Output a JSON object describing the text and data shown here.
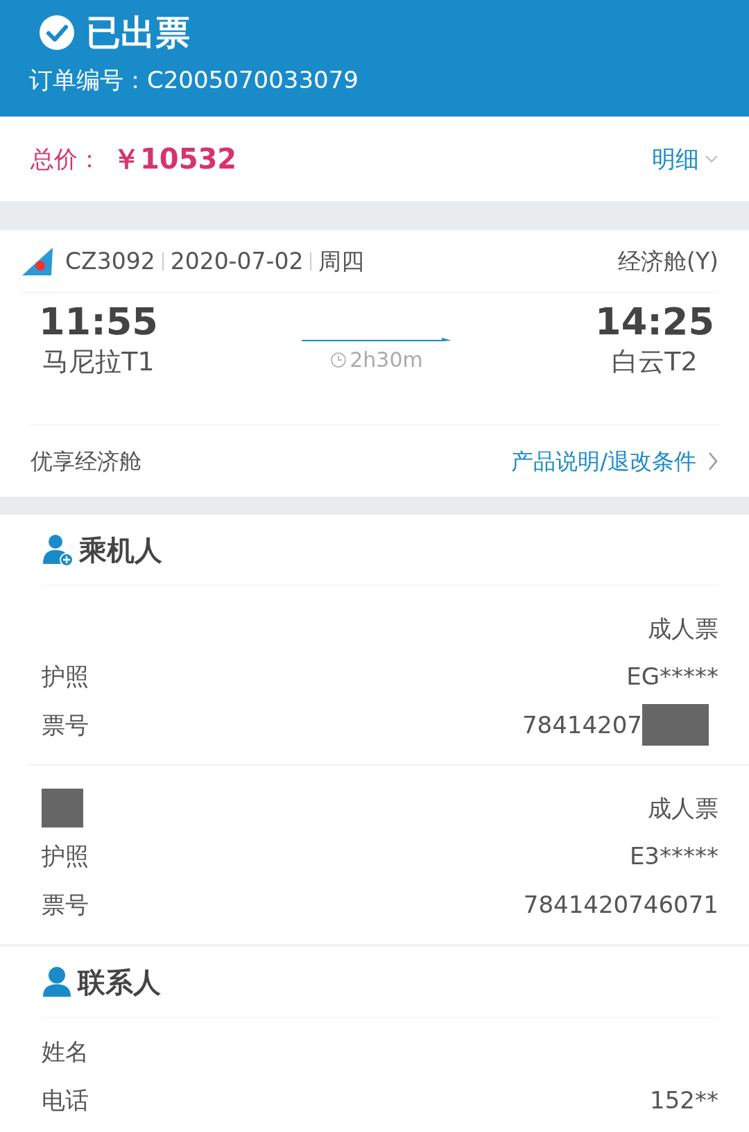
{
  "header": {
    "status": "已出票",
    "order_label": "订单编号：",
    "order_number": "C2005070033079"
  },
  "price": {
    "label": "总价：",
    "amount": "￥10532",
    "detail_link": "明细"
  },
  "flight": {
    "number": "CZ3092",
    "date": "2020-07-02",
    "weekday": "周四",
    "cabin": "经济舱(Y)",
    "departure": {
      "time": "11:55",
      "airport": "马尼拉T1"
    },
    "duration": "2h30m",
    "arrival": {
      "time": "14:25",
      "airport": "白云T2"
    },
    "product": "优享经济舱",
    "rules_link": "产品说明/退改条件"
  },
  "passengers": {
    "title": "乘机人",
    "items": [
      {
        "name_redacted": false,
        "ticket_type": "成人票",
        "passport_label": "护照",
        "passport": "EG*****",
        "ticket_label": "票号",
        "ticket_number": "78414207",
        "number_redacted": true
      },
      {
        "name_redacted": true,
        "ticket_type": "成人票",
        "passport_label": "护照",
        "passport": "E3*****",
        "ticket_label": "票号",
        "ticket_number": "7841420746071",
        "number_redacted": false
      }
    ]
  },
  "contact": {
    "title": "联系人",
    "rows": [
      {
        "label": "姓名"
      },
      {
        "label": "电话",
        "value": "152**"
      }
    ]
  }
}
